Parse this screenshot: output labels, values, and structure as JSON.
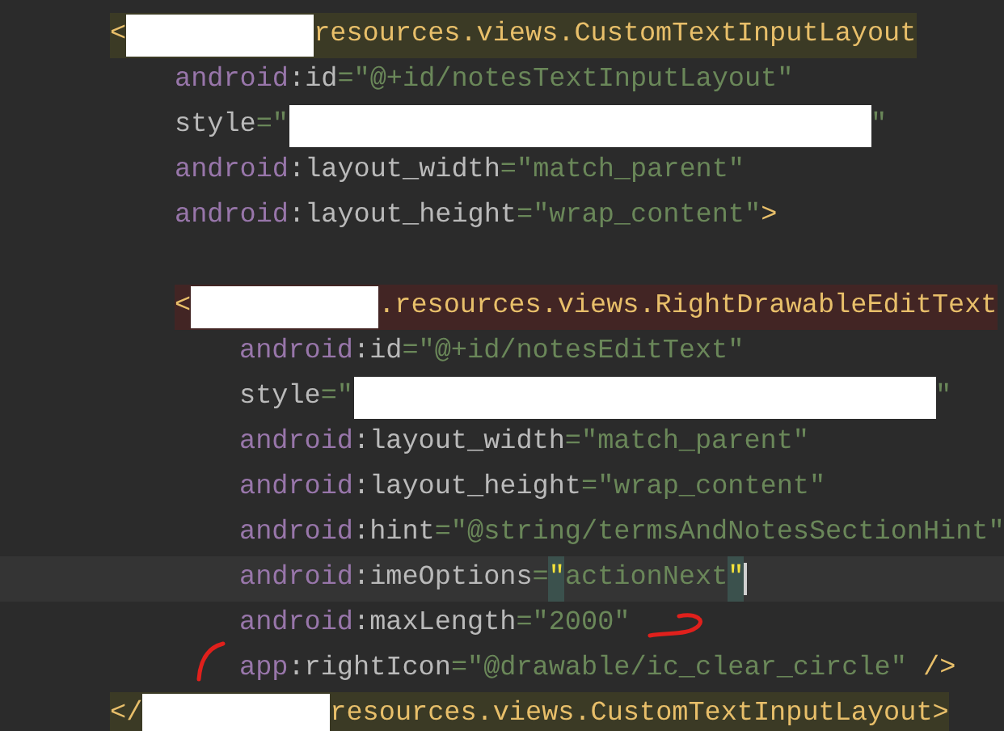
{
  "editor": {
    "root": {
      "open": {
        "kind": "matched",
        "tokens": [
          {
            "kind": "bracket",
            "text": "<"
          },
          {
            "kind": "redacted-name"
          },
          {
            "kind": "tag",
            "text": "resources.views.CustomTextInputLayout"
          }
        ]
      },
      "attributes": [
        {
          "tokens": [
            {
              "kind": "ns",
              "text": "android"
            },
            {
              "kind": "attr",
              "text": ":id"
            },
            {
              "kind": "string",
              "text": "=\"@+id/notesTextInputLayout\""
            }
          ]
        },
        {
          "tokens": [
            {
              "kind": "attr",
              "text": "style"
            },
            {
              "kind": "string",
              "text": "=\""
            },
            {
              "kind": "redacted-style"
            },
            {
              "kind": "string",
              "text": "\""
            }
          ]
        },
        {
          "tokens": [
            {
              "kind": "ns",
              "text": "android"
            },
            {
              "kind": "attr",
              "text": ":layout_width"
            },
            {
              "kind": "string",
              "text": "=\"match_parent\""
            }
          ]
        },
        {
          "tokens": [
            {
              "kind": "ns",
              "text": "android"
            },
            {
              "kind": "attr",
              "text": ":layout_height"
            },
            {
              "kind": "string",
              "text": "=\"wrap_content\""
            },
            {
              "kind": "bracket",
              "text": ">"
            }
          ]
        }
      ],
      "children": [
        {
          "blank_before": true,
          "open": {
            "kind": "unresolved",
            "tokens": [
              {
                "kind": "bracket",
                "text": "<"
              },
              {
                "kind": "redacted-name"
              },
              {
                "kind": "tag",
                "text": ".resources.views.RightDrawableEditText"
              }
            ]
          },
          "attributes": [
            {
              "tokens": [
                {
                  "kind": "ns",
                  "text": "android"
                },
                {
                  "kind": "attr",
                  "text": ":id"
                },
                {
                  "kind": "string",
                  "text": "=\"@+id/notesEditText\""
                }
              ]
            },
            {
              "tokens": [
                {
                  "kind": "attr",
                  "text": "style"
                },
                {
                  "kind": "string",
                  "text": "=\""
                },
                {
                  "kind": "redacted-style"
                },
                {
                  "kind": "string",
                  "text": "\""
                }
              ]
            },
            {
              "tokens": [
                {
                  "kind": "ns",
                  "text": "android"
                },
                {
                  "kind": "attr",
                  "text": ":layout_width"
                },
                {
                  "kind": "string",
                  "text": "=\"match_parent\""
                }
              ]
            },
            {
              "tokens": [
                {
                  "kind": "ns",
                  "text": "android"
                },
                {
                  "kind": "attr",
                  "text": ":layout_height"
                },
                {
                  "kind": "string",
                  "text": "=\"wrap_content\""
                }
              ]
            },
            {
              "tokens": [
                {
                  "kind": "ns",
                  "text": "android"
                },
                {
                  "kind": "attr",
                  "text": ":hint"
                },
                {
                  "kind": "string",
                  "text": "=\"@string/termsAndNotesSectionHint\""
                }
              ]
            },
            {
              "current": true,
              "tokens": [
                {
                  "kind": "ns",
                  "text": "android"
                },
                {
                  "kind": "attr",
                  "text": ":imeOptions"
                },
                {
                  "kind": "string",
                  "text": "="
                },
                {
                  "kind": "matched-quote",
                  "text": "\""
                },
                {
                  "kind": "string",
                  "text": "actionNext"
                },
                {
                  "kind": "matched-quote",
                  "text": "\""
                },
                {
                  "kind": "caret"
                }
              ]
            },
            {
              "tokens": [
                {
                  "kind": "ns",
                  "text": "android"
                },
                {
                  "kind": "attr",
                  "text": ":maxLength"
                },
                {
                  "kind": "string",
                  "text": "=\"2000\""
                },
                {
                  "kind": "scribble"
                }
              ]
            },
            {
              "tokens": [
                {
                  "kind": "ns",
                  "text": "app"
                },
                {
                  "kind": "attr",
                  "text": ":rightIcon"
                },
                {
                  "kind": "string",
                  "text": "=\"@drawable/ic_clear_circle\""
                },
                {
                  "kind": "bracket",
                  "text": " />"
                }
              ]
            }
          ]
        }
      ],
      "close": {
        "kind": "matched",
        "tokens": [
          {
            "kind": "bracket",
            "text": "</"
          },
          {
            "kind": "redacted-name"
          },
          {
            "kind": "tag",
            "text": "resources.views.CustomTextInputLayout>"
          }
        ]
      }
    }
  }
}
